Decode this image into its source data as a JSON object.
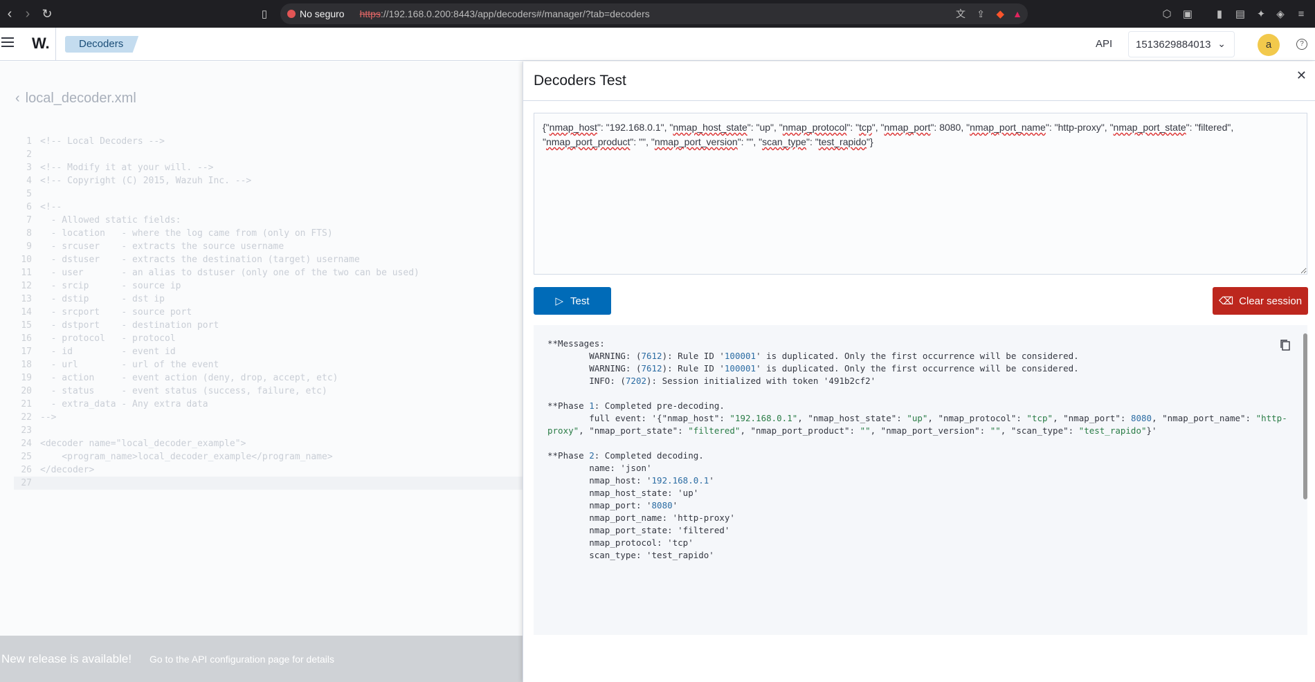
{
  "browser": {
    "security_label": "No seguro",
    "url_scheme": "https",
    "url_rest": "://192.168.0.200:8443/app/decoders#/manager/?tab=decoders"
  },
  "header": {
    "logo": "W.",
    "breadcrumb": "Decoders",
    "api_label": "API",
    "api_selected": "1513629884013",
    "avatar_letter": "a",
    "help": "?"
  },
  "editor": {
    "file_name": "local_decoder.xml",
    "lines": [
      {
        "n": "1",
        "t": "<!-- Local Decoders -->"
      },
      {
        "n": "2",
        "t": ""
      },
      {
        "n": "3",
        "t": "<!-- Modify it at your will. -->"
      },
      {
        "n": "4",
        "t": "<!-- Copyright (C) 2015, Wazuh Inc. -->"
      },
      {
        "n": "5",
        "t": ""
      },
      {
        "n": "6",
        "t": "<!--"
      },
      {
        "n": "7",
        "t": "  - Allowed static fields:"
      },
      {
        "n": "8",
        "t": "  - location   - where the log came from (only on FTS)"
      },
      {
        "n": "9",
        "t": "  - srcuser    - extracts the source username"
      },
      {
        "n": "10",
        "t": "  - dstuser    - extracts the destination (target) username"
      },
      {
        "n": "11",
        "t": "  - user       - an alias to dstuser (only one of the two can be used)"
      },
      {
        "n": "12",
        "t": "  - srcip      - source ip"
      },
      {
        "n": "13",
        "t": "  - dstip      - dst ip"
      },
      {
        "n": "14",
        "t": "  - srcport    - source port"
      },
      {
        "n": "15",
        "t": "  - dstport    - destination port"
      },
      {
        "n": "16",
        "t": "  - protocol   - protocol"
      },
      {
        "n": "17",
        "t": "  - id         - event id"
      },
      {
        "n": "18",
        "t": "  - url        - url of the event"
      },
      {
        "n": "19",
        "t": "  - action     - event action (deny, drop, accept, etc)"
      },
      {
        "n": "20",
        "t": "  - status     - event status (success, failure, etc)"
      },
      {
        "n": "21",
        "t": "  - extra_data - Any extra data"
      },
      {
        "n": "22",
        "t": "-->"
      },
      {
        "n": "23",
        "t": ""
      },
      {
        "n": "24",
        "t": "<decoder name=\"local_decoder_example\">"
      },
      {
        "n": "25",
        "t": "    <program_name>local_decoder_example</program_name>"
      },
      {
        "n": "26",
        "t": "</decoder>"
      },
      {
        "n": "27",
        "t": ""
      }
    ]
  },
  "banner": {
    "title": "New release is available!",
    "link": "Go to the API configuration page for details"
  },
  "flyout": {
    "title": "Decoders Test",
    "input_line1_parts": [
      {
        "t": "{\"",
        "sq": false
      },
      {
        "t": "nmap_host",
        "sq": true
      },
      {
        "t": "\": \"192.168.0.1\", \"",
        "sq": false
      },
      {
        "t": "nmap_host_state",
        "sq": true
      },
      {
        "t": "\": \"up\", \"",
        "sq": false
      },
      {
        "t": "nmap_protocol",
        "sq": true
      },
      {
        "t": "\": \"",
        "sq": false
      },
      {
        "t": "tcp",
        "sq": true
      },
      {
        "t": "\", \"",
        "sq": false
      },
      {
        "t": "nmap_port",
        "sq": true
      },
      {
        "t": "\": 8080, \"",
        "sq": false
      },
      {
        "t": "nmap_port_name",
        "sq": true
      },
      {
        "t": "\": \"http-proxy\", \"",
        "sq": false
      },
      {
        "t": "nmap_port_state",
        "sq": true
      },
      {
        "t": "\": \"filtered\",",
        "sq": false
      }
    ],
    "input_line2_parts": [
      {
        "t": "\"",
        "sq": false
      },
      {
        "t": "nmap_port_product",
        "sq": true
      },
      {
        "t": "\": \"\", \"",
        "sq": false
      },
      {
        "t": "nmap_port_version",
        "sq": true
      },
      {
        "t": "\": \"\", \"",
        "sq": false
      },
      {
        "t": "scan_type",
        "sq": true
      },
      {
        "t": "\": \"",
        "sq": false
      },
      {
        "t": "test_rapido",
        "sq": true
      },
      {
        "t": "\"}",
        "sq": false
      }
    ],
    "test_button": "Test",
    "clear_button": "Clear session",
    "output_lines": [
      [
        {
          "t": "**Messages:",
          "c": ""
        }
      ],
      [
        {
          "t": "        WARNING: (",
          "c": ""
        },
        {
          "t": "7612",
          "c": "n"
        },
        {
          "t": "): Rule ID '",
          "c": ""
        },
        {
          "t": "100001",
          "c": "n"
        },
        {
          "t": "' is duplicated. Only the first occurrence will be considered.",
          "c": ""
        }
      ],
      [
        {
          "t": "        WARNING: (",
          "c": ""
        },
        {
          "t": "7612",
          "c": "n"
        },
        {
          "t": "): Rule ID '",
          "c": ""
        },
        {
          "t": "100001",
          "c": "n"
        },
        {
          "t": "' is duplicated. Only the first occurrence will be considered.",
          "c": ""
        }
      ],
      [
        {
          "t": "        INFO: (",
          "c": ""
        },
        {
          "t": "7202",
          "c": "n"
        },
        {
          "t": "): Session initialized with token '491b2cf2'",
          "c": ""
        }
      ],
      [
        {
          "t": "",
          "c": ""
        }
      ],
      [
        {
          "t": "**Phase ",
          "c": ""
        },
        {
          "t": "1",
          "c": "n"
        },
        {
          "t": ": Completed pre-decoding.",
          "c": ""
        }
      ],
      [
        {
          "t": "        full event: '{\"nmap_host\": ",
          "c": ""
        },
        {
          "t": "\"192.168.0.1\"",
          "c": "s"
        },
        {
          "t": ", \"nmap_host_state\": ",
          "c": ""
        },
        {
          "t": "\"up\"",
          "c": "s"
        },
        {
          "t": ", \"nmap_protocol\": ",
          "c": ""
        },
        {
          "t": "\"tcp\"",
          "c": "s"
        },
        {
          "t": ", \"nmap_port\": ",
          "c": ""
        },
        {
          "t": "8080",
          "c": "n"
        },
        {
          "t": ", \"nmap_port_name\": ",
          "c": ""
        },
        {
          "t": "\"http-proxy\"",
          "c": "s"
        },
        {
          "t": ", \"nmap_port_state\": ",
          "c": ""
        },
        {
          "t": "\"filtered\"",
          "c": "s"
        },
        {
          "t": ", \"nmap_port_product\": ",
          "c": ""
        },
        {
          "t": "\"\"",
          "c": "s"
        },
        {
          "t": ", \"nmap_port_version\": ",
          "c": ""
        },
        {
          "t": "\"\"",
          "c": "s"
        },
        {
          "t": ", \"scan_type\": ",
          "c": ""
        },
        {
          "t": "\"test_rapido\"",
          "c": "s"
        },
        {
          "t": "}'",
          "c": ""
        }
      ],
      [
        {
          "t": "",
          "c": ""
        }
      ],
      [
        {
          "t": "**Phase ",
          "c": ""
        },
        {
          "t": "2",
          "c": "n"
        },
        {
          "t": ": Completed decoding.",
          "c": ""
        }
      ],
      [
        {
          "t": "        name: 'json'",
          "c": ""
        }
      ],
      [
        {
          "t": "        nmap_host: '",
          "c": ""
        },
        {
          "t": "192.168.0.1",
          "c": "n"
        },
        {
          "t": "'",
          "c": ""
        }
      ],
      [
        {
          "t": "        nmap_host_state: 'up'",
          "c": ""
        }
      ],
      [
        {
          "t": "        nmap_port: '",
          "c": ""
        },
        {
          "t": "8080",
          "c": "n"
        },
        {
          "t": "'",
          "c": ""
        }
      ],
      [
        {
          "t": "        nmap_port_name: 'http-proxy'",
          "c": ""
        }
      ],
      [
        {
          "t": "        nmap_port_state: 'filtered'",
          "c": ""
        }
      ],
      [
        {
          "t": "        nmap_protocol: 'tcp'",
          "c": ""
        }
      ],
      [
        {
          "t": "        scan_type: 'test_rapido'",
          "c": ""
        }
      ]
    ]
  }
}
